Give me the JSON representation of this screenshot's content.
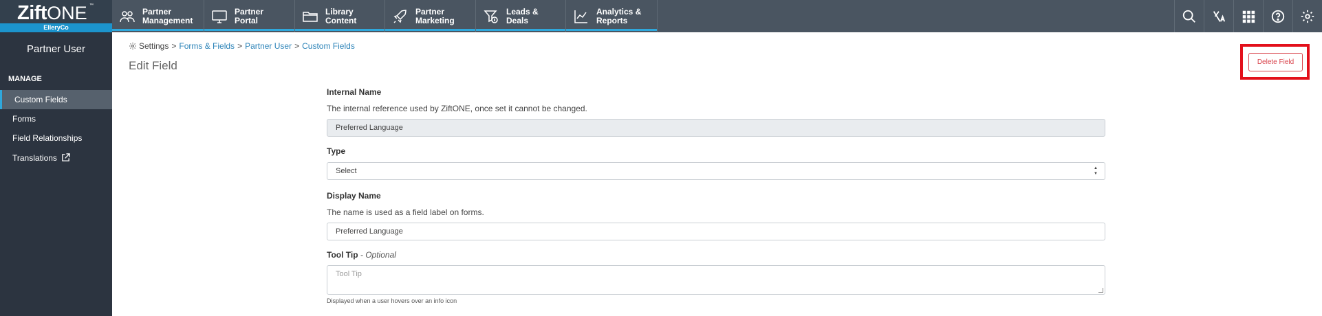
{
  "brand": {
    "name": "Zift",
    "suffix": "ONE",
    "tm": "™",
    "company": "ElleryCo"
  },
  "nav": {
    "items": [
      {
        "label": "Partner\nManagement",
        "icon": "partners-icon"
      },
      {
        "label": "Partner\nPortal",
        "icon": "monitor-icon"
      },
      {
        "label": "Library\nContent",
        "icon": "folder-icon"
      },
      {
        "label": "Partner\nMarketing",
        "icon": "rocket-icon"
      },
      {
        "label": "Leads &\nDeals",
        "icon": "funnel-dollar-icon"
      },
      {
        "label": "Analytics &\nReports",
        "icon": "line-chart-icon"
      }
    ],
    "utilities": [
      "search-icon",
      "translate-icon",
      "apps-grid-icon",
      "help-icon",
      "settings-gear-icon"
    ]
  },
  "sidebar": {
    "title": "Partner User",
    "section": "MANAGE",
    "items": [
      {
        "label": "Custom Fields",
        "active": true
      },
      {
        "label": "Forms",
        "active": false
      },
      {
        "label": "Field Relationships",
        "active": false
      },
      {
        "label": "Translations",
        "active": false
      }
    ]
  },
  "breadcrumb": {
    "root": "Settings",
    "sep": ">",
    "links": [
      "Forms & Fields",
      "Partner User",
      "Custom Fields"
    ]
  },
  "page": {
    "title": "Edit Field",
    "delete_label": "Delete Field"
  },
  "form": {
    "internal_name": {
      "label": "Internal Name",
      "help": "The internal reference used by ZiftONE, once set it cannot be changed.",
      "value": "Preferred Language"
    },
    "type": {
      "label": "Type",
      "value": "Select"
    },
    "display_name": {
      "label": "Display Name",
      "help": "The name is used as a field label on forms.",
      "value": "Preferred Language"
    },
    "tooltip": {
      "label": "Tool Tip",
      "optional": " - Optional",
      "placeholder": "Tool Tip",
      "help": "Displayed when a user hovers over an info icon"
    }
  },
  "colors": {
    "topbar": "#4a5561",
    "sidebar": "#2c3440",
    "accent": "#2fa8dc",
    "danger": "#e3101b",
    "link": "#2b83b8"
  }
}
